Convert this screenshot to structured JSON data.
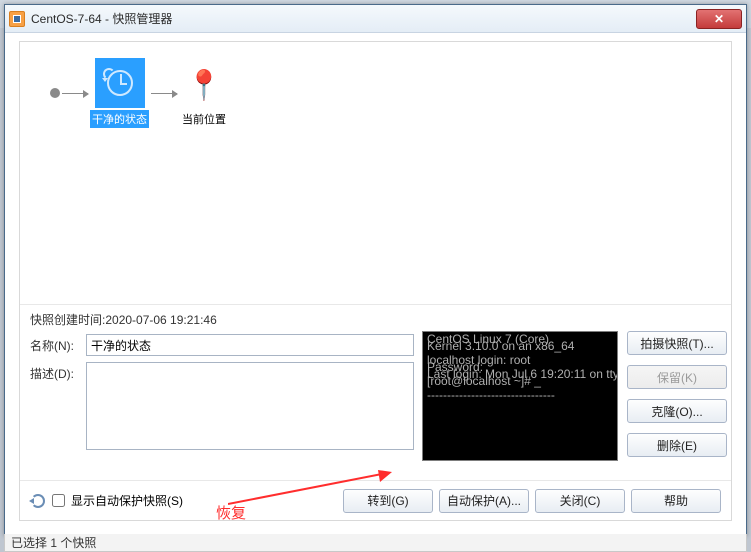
{
  "window": {
    "title": "CentOS-7-64 - 快照管理器"
  },
  "timeline": {
    "snapshot_label": "干净的状态",
    "current_label": "当前位置"
  },
  "details": {
    "created_label": "快照创建时间:",
    "created_value": "2020-07-06 19:21:46",
    "name_label": "名称(N):",
    "name_value": "干净的状态",
    "desc_label": "描述(D):",
    "desc_value": ""
  },
  "side_buttons": {
    "take": "拍摄快照(T)...",
    "keep": "保留(K)",
    "clone": "克隆(O)...",
    "delete": "删除(E)"
  },
  "bottom": {
    "autoprotect_chk": "显示自动保护快照(S)",
    "goto": "转到(G)",
    "autoprotect": "自动保护(A)...",
    "close": "关闭(C)",
    "help": "帮助"
  },
  "status": {
    "text": "已选择 1 个快照"
  },
  "annotation": {
    "text": "恢复"
  }
}
